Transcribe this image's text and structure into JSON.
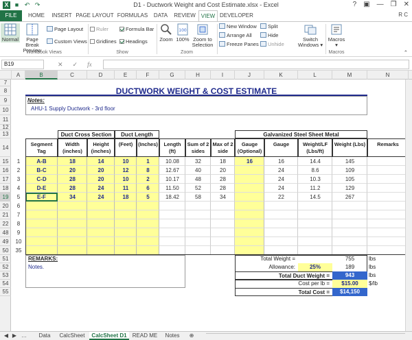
{
  "window": {
    "title": "D1 - Ductwork Weight and Cost Estimate.xlsx - Excel",
    "user": "R C"
  },
  "ribbon_tabs": [
    "FILE",
    "HOME",
    "INSERT",
    "PAGE LAYOUT",
    "FORMULAS",
    "DATA",
    "REVIEW",
    "VIEW",
    "DEVELOPER"
  ],
  "ribbon": {
    "normal": "Normal",
    "page_break_preview": "Page Break Preview",
    "page_layout": "Page Layout",
    "custom_views": "Custom Views",
    "ruler": "Ruler",
    "gridlines": "Gridlines",
    "formula_bar": "Formula Bar",
    "headings": "Headings",
    "zoom": "Zoom",
    "zoom_100": "100%",
    "zoom_to_selection": "Zoom to Selection",
    "new_window": "New Window",
    "arrange_all": "Arrange All",
    "freeze_panes": "Freeze Panes",
    "split": "Split",
    "hide": "Hide",
    "unhide": "Unhide",
    "switch_windows": "Switch Windows",
    "macros": "Macros",
    "groups": {
      "workbook_views": "Workbook Views",
      "show": "Show",
      "zoom": "Zoom",
      "macros": "Macros"
    }
  },
  "formula_bar": {
    "name_box": "B19",
    "fx": "fx"
  },
  "columns": [
    "A",
    "B",
    "C",
    "D",
    "E",
    "F",
    "G",
    "H",
    "I",
    "J",
    "K",
    "L",
    "M",
    "N"
  ],
  "rows": [
    "7",
    "8",
    "9",
    "10",
    "11",
    "12",
    "13",
    "14",
    "15",
    "16",
    "17",
    "18",
    "19",
    "20",
    "21",
    "22",
    "48",
    "49",
    "50",
    "51",
    "52",
    "53",
    "54",
    "55"
  ],
  "sheet": {
    "title": "DUCTWORK WEIGHT & COST ESTIMATE",
    "notes_label": "Notes:",
    "notes_text": "AHU-1 Supply Ductwork - 3rd floor",
    "headers": {
      "duct_cross_section": "Duct Cross Section",
      "duct_length": "Duct Length",
      "galvanized": "Galvanized Steel Sheet Metal",
      "segment_tag": "Segment Tag",
      "width": "Width (inches)",
      "height": "Height (inches)",
      "feet": "(Feet)",
      "inches": "(Inches)",
      "length": "Length (ft)",
      "sum_2": "Sum of 2 sides",
      "max_2": "Max of 2 side",
      "gauge_opt": "Gauge (Optional)",
      "gauge": "Gauge",
      "weight_lf": "Weight/LF (Lbs/ft)",
      "weight": "Weight (Lbs)",
      "remarks": "Remarks"
    },
    "data_rows": [
      {
        "n": "1",
        "tag": "A-B",
        "w": "18",
        "h": "14",
        "ft": "10",
        "in": "1",
        "len": "10.08",
        "sum": "32",
        "max": "18",
        "gopt": "16",
        "gauge": "16",
        "wlf": "14.4",
        "wt": "145"
      },
      {
        "n": "2",
        "tag": "B-C",
        "w": "20",
        "h": "20",
        "ft": "12",
        "in": "8",
        "len": "12.67",
        "sum": "40",
        "max": "20",
        "gopt": "",
        "gauge": "24",
        "wlf": "8.6",
        "wt": "109"
      },
      {
        "n": "3",
        "tag": "C-D",
        "w": "28",
        "h": "20",
        "ft": "10",
        "in": "2",
        "len": "10.17",
        "sum": "48",
        "max": "28",
        "gopt": "",
        "gauge": "24",
        "wlf": "10.3",
        "wt": "105"
      },
      {
        "n": "4",
        "tag": "D-E",
        "w": "28",
        "h": "24",
        "ft": "11",
        "in": "6",
        "len": "11.50",
        "sum": "52",
        "max": "28",
        "gopt": "",
        "gauge": "24",
        "wlf": "11.2",
        "wt": "129"
      },
      {
        "n": "5",
        "tag": "E-F",
        "w": "34",
        "h": "24",
        "ft": "18",
        "in": "5",
        "len": "18.42",
        "sum": "58",
        "max": "34",
        "gopt": "",
        "gauge": "22",
        "wlf": "14.5",
        "wt": "267"
      }
    ],
    "empty_row_nums": [
      "6",
      "7",
      "8",
      "9",
      "10",
      "35"
    ],
    "remarks_label": "REMARKS:",
    "remarks_text": "Notes.",
    "total_weight_label": "Total Weight =",
    "total_weight_value": "755",
    "lbs": "lbs",
    "allowance_label": "Allowance:",
    "allowance_pct": "25%",
    "allowance_value": "189",
    "total_duct_weight_label": "Total Duct Weight =",
    "total_duct_weight_value": "943",
    "cost_per_lb_label": "Cost per lb =",
    "cost_per_lb_value": "$15.00",
    "per_lb_unit": "$/lb",
    "total_cost_label": "Total Cost =",
    "total_cost_value": "$14,150"
  },
  "sheet_tabs": [
    "Data",
    "CalcSheet",
    "CalcSheet D1",
    "READ ME",
    "Notes"
  ],
  "colors": {
    "excel_green": "#217346",
    "title_blue": "#1f2a8c",
    "highlight_yellow": "#ffff99",
    "total_blue": "#3366cc"
  }
}
